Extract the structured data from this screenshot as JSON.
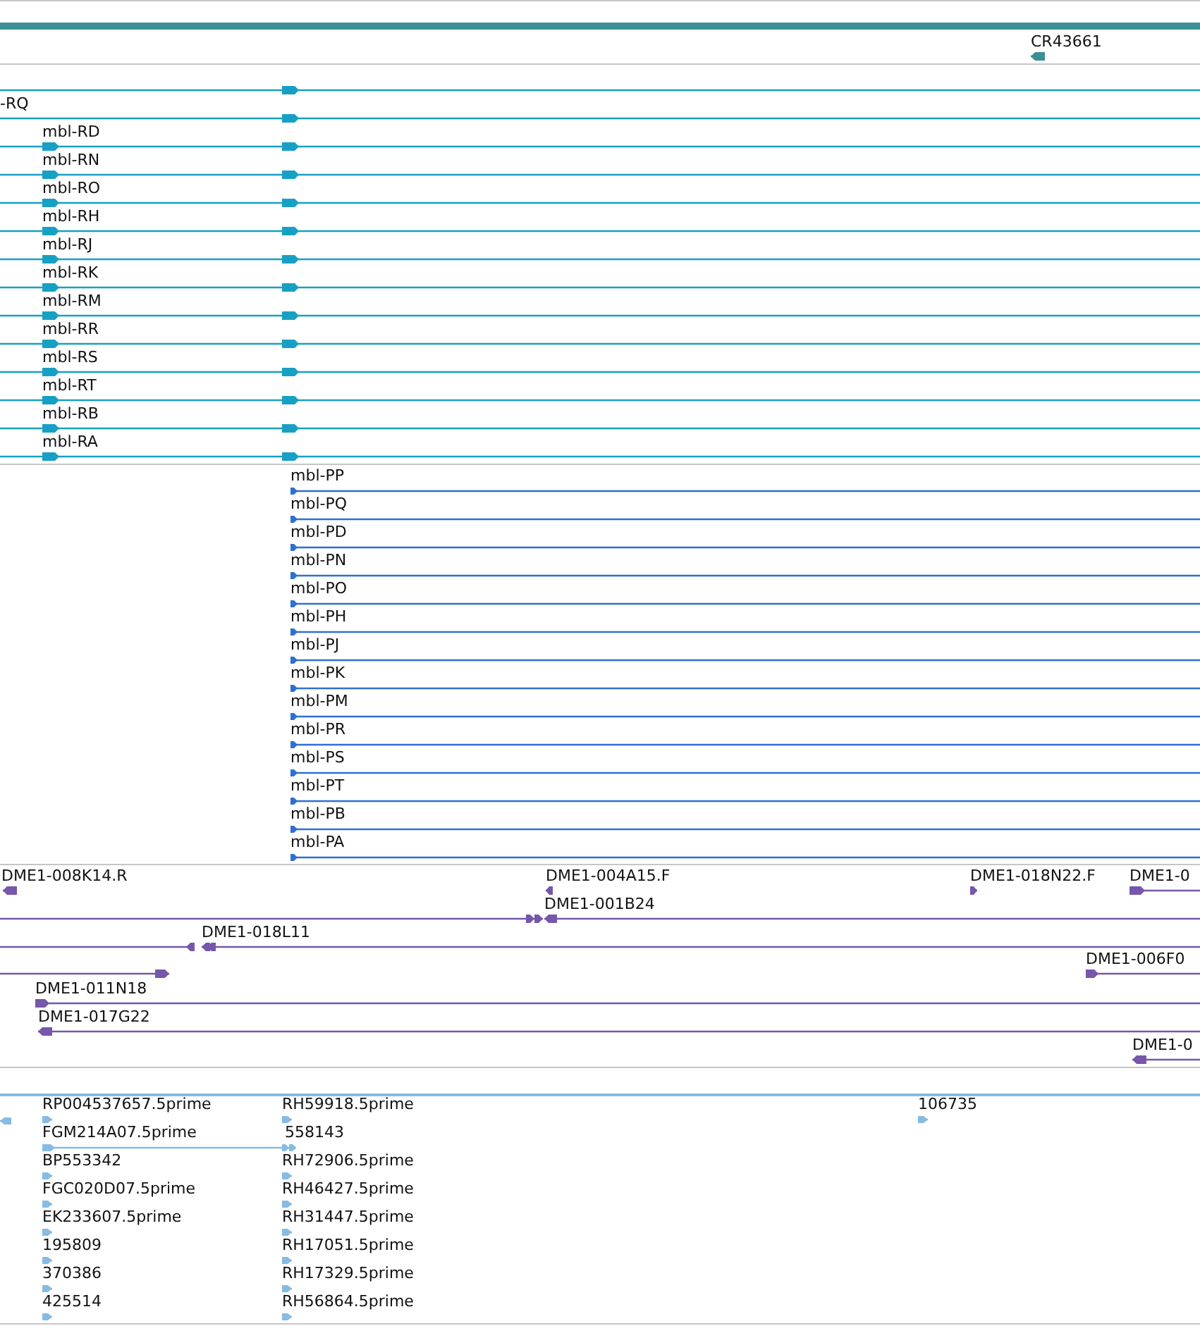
{
  "tracks": [
    {
      "kind": "gene",
      "features": [
        {
          "kind": "span"
        },
        {
          "label": "CR43661",
          "kind": "reverse"
        }
      ]
    },
    {
      "kind": "transcript",
      "features": [
        {
          "kind": "forward"
        },
        {
          "label": "-RQ",
          "kind": "forward"
        },
        {
          "label": "mbl-RD",
          "kind": "forward"
        },
        {
          "label": "mbl-RN",
          "kind": "forward"
        },
        {
          "label": "mbl-RO",
          "kind": "forward"
        },
        {
          "label": "mbl-RH",
          "kind": "forward"
        },
        {
          "label": "mbl-RJ",
          "kind": "forward"
        },
        {
          "label": "mbl-RK",
          "kind": "forward"
        },
        {
          "label": "mbl-RM",
          "kind": "forward"
        },
        {
          "label": "mbl-RR",
          "kind": "forward"
        },
        {
          "label": "mbl-RS",
          "kind": "forward"
        },
        {
          "label": "mbl-RT",
          "kind": "forward"
        },
        {
          "label": "mbl-RB",
          "kind": "forward"
        },
        {
          "label": "mbl-RA",
          "kind": "forward"
        }
      ]
    },
    {
      "kind": "protein",
      "features": [
        {
          "label": "mbl-PP",
          "kind": "forward"
        },
        {
          "label": "mbl-PQ",
          "kind": "forward"
        },
        {
          "label": "mbl-PD",
          "kind": "forward"
        },
        {
          "label": "mbl-PN",
          "kind": "forward"
        },
        {
          "label": "mbl-PO",
          "kind": "forward"
        },
        {
          "label": "mbl-PH",
          "kind": "forward"
        },
        {
          "label": "mbl-PJ",
          "kind": "forward"
        },
        {
          "label": "mbl-PK",
          "kind": "forward"
        },
        {
          "label": "mbl-PM",
          "kind": "forward"
        },
        {
          "label": "mbl-PR",
          "kind": "forward"
        },
        {
          "label": "mbl-PS",
          "kind": "forward"
        },
        {
          "label": "mbl-PT",
          "kind": "forward"
        },
        {
          "label": "mbl-PB",
          "kind": "forward"
        },
        {
          "label": "mbl-PA",
          "kind": "forward"
        }
      ]
    },
    {
      "kind": "clone",
      "features": [
        {
          "label": "DME1-008K14.R",
          "kind": "reverse"
        },
        {
          "label": "DME1-004A15.F",
          "kind": "reverse"
        },
        {
          "label": "DME1-018N22.F",
          "kind": "forward"
        },
        {
          "label": "DME1-0",
          "kind": "forward"
        },
        {
          "kind": "forward"
        },
        {
          "label": "DME1-001B24",
          "kind": "reverse"
        },
        {
          "kind": "reverse"
        },
        {
          "label": "DME1-018L11",
          "kind": "reverse"
        },
        {
          "kind": "forward"
        },
        {
          "label": "DME1-006F0",
          "kind": "forward"
        },
        {
          "label": "DME1-011N18",
          "kind": "forward"
        },
        {
          "label": "DME1-017G22",
          "kind": "reverse"
        },
        {
          "label": "DME1-0",
          "kind": "reverse"
        }
      ]
    },
    {
      "kind": "est",
      "features": [
        {
          "kind": "reverse"
        },
        {
          "label": "RP004537657.5prime",
          "kind": "forward"
        },
        {
          "label": "RH59918.5prime",
          "kind": "forward"
        },
        {
          "label": "106735",
          "kind": "forward"
        },
        {
          "label": "FGM214A07.5prime",
          "kind": "forward"
        },
        {
          "label": "558143",
          "kind": "forward"
        },
        {
          "label": "BP553342",
          "kind": "forward"
        },
        {
          "label": "RH72906.5prime",
          "kind": "forward"
        },
        {
          "label": "FGC020D07.5prime",
          "kind": "forward"
        },
        {
          "label": "RH46427.5prime",
          "kind": "forward"
        },
        {
          "label": "EK233607.5prime",
          "kind": "forward"
        },
        {
          "label": "RH31447.5prime",
          "kind": "forward"
        },
        {
          "label": "195809",
          "kind": "forward"
        },
        {
          "label": "RH17051.5prime",
          "kind": "forward"
        },
        {
          "label": "370386",
          "kind": "forward"
        },
        {
          "label": "RH17329.5prime",
          "kind": "forward"
        },
        {
          "label": "425514",
          "kind": "forward"
        },
        {
          "label": "RH56864.5prime",
          "kind": "forward"
        }
      ]
    }
  ]
}
